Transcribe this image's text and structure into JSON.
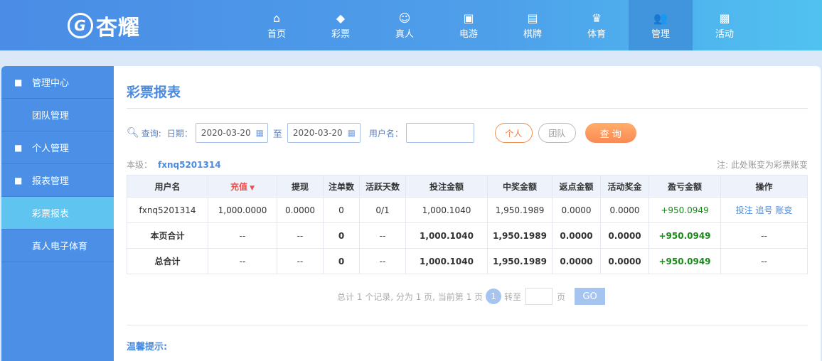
{
  "header": {
    "logo_text": "杏耀",
    "nav": [
      {
        "label": "首页",
        "icon": "home-icon",
        "glyph": "⌂"
      },
      {
        "label": "彩票",
        "icon": "lottery-icon",
        "glyph": "◆"
      },
      {
        "label": "真人",
        "icon": "live-dealer-icon",
        "glyph": "☺"
      },
      {
        "label": "电游",
        "icon": "slot-icon",
        "glyph": "▣"
      },
      {
        "label": "棋牌",
        "icon": "cards-icon",
        "glyph": "▤"
      },
      {
        "label": "体育",
        "icon": "trophy-icon",
        "glyph": "♛"
      },
      {
        "label": "管理",
        "icon": "users-icon",
        "glyph": "👥"
      },
      {
        "label": "活动",
        "icon": "gift-icon",
        "glyph": "▩"
      }
    ],
    "active": "管理"
  },
  "sidebar": {
    "items": [
      {
        "label": "管理中心",
        "type": "head",
        "icon": "users-icon"
      },
      {
        "label": "团队管理",
        "type": "sub"
      },
      {
        "label": "个人管理",
        "type": "head",
        "icon": "user-icon"
      },
      {
        "label": "报表管理",
        "type": "head",
        "icon": "report-icon"
      },
      {
        "label": "彩票报表",
        "type": "sub",
        "active": true
      },
      {
        "label": "真人电子体育",
        "type": "sub"
      }
    ]
  },
  "main": {
    "title": "彩票报表",
    "query": {
      "label": "查询:",
      "date_label": "日期：",
      "start": "2020-03-20",
      "to": "至",
      "end": "2020-03-20",
      "user_label": "用户名：",
      "user_value": "",
      "personal": "个人",
      "team": "团队",
      "submit": "查 询"
    },
    "level_label": "本级：",
    "level_user": "fxnq5201314",
    "note": "注: 此处账变为彩票账变",
    "table": {
      "headers": [
        "用户名",
        "充值",
        "提现",
        "注单数",
        "活跃天数",
        "投注金额",
        "中奖金额",
        "返点金额",
        "活动奖金",
        "盈亏金额",
        "操作"
      ],
      "rows": [
        [
          "fxnq5201314",
          "1,000.0000",
          "0.0000",
          "0",
          "0/1",
          "1,000.1040",
          "1,950.1989",
          "0.0000",
          "0.0000",
          "+950.0949",
          "投注 追号 账变"
        ],
        [
          "本页合计",
          "--",
          "--",
          "0",
          "--",
          "1,000.1040",
          "1,950.1989",
          "0.0000",
          "0.0000",
          "+950.0949",
          "--"
        ],
        [
          "总合计",
          "--",
          "--",
          "0",
          "--",
          "1,000.1040",
          "1,950.1989",
          "0.0000",
          "0.0000",
          "+950.0949",
          "--"
        ]
      ]
    },
    "pager": {
      "summary": "总计 1 个记录, 分为 1 页, 当前第 1 页",
      "current": "1",
      "goto": "转至",
      "page": "页",
      "go": "GO"
    },
    "tip_title": "温馨提示:"
  }
}
